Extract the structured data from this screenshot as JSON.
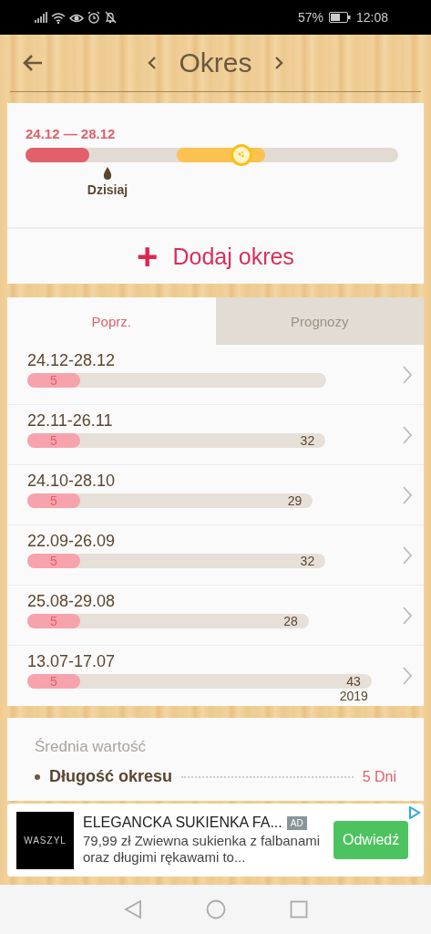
{
  "status_bar": {
    "battery": "57%",
    "time": "12:08"
  },
  "header": {
    "title": "Okres"
  },
  "current": {
    "range": "24.12 — 28.12",
    "period_bar": {
      "level": 0.17
    },
    "today_marker": {
      "level": 0.22,
      "label": "Dzisiaj"
    },
    "add_button": {
      "icon": "+",
      "label": "Dodaj okres"
    }
  },
  "tabs": [
    {
      "label": "Poprz.",
      "selected": true
    },
    {
      "label": "Prognozy",
      "selected": false
    }
  ],
  "periods": [
    {
      "dates": "24.12-28.12",
      "period_days": "5",
      "period_bar": {
        "level": 0.145
      }
    },
    {
      "dates": "22.11-26.11",
      "period_days": "5",
      "cycle_days": "32",
      "period_bar": {
        "level": 0.145
      }
    },
    {
      "dates": "24.10-28.10",
      "period_days": "5",
      "cycle_days": "29",
      "period_bar": {
        "level": 0.145
      }
    },
    {
      "dates": "22.09-26.09",
      "period_days": "5",
      "cycle_days": "32",
      "period_bar": {
        "level": 0.145
      }
    },
    {
      "dates": "25.08-29.08",
      "period_days": "5",
      "cycle_days": "28",
      "period_bar": {
        "level": 0.145
      }
    },
    {
      "dates": "13.07-17.07",
      "period_days": "5",
      "cycle_days": "43",
      "year": "2019",
      "period_bar": {
        "level": 0.145
      }
    }
  ],
  "average": {
    "title": "Średnia wartość",
    "rows": [
      {
        "label": "Długość okresu",
        "value": "5 Dni"
      }
    ]
  },
  "ad": {
    "logo": "WASZYL",
    "title": "ELEGANCKA SUKIENKA FA...",
    "badge": "AD",
    "text": "79,99 zł Zwiewna sukienka z falbanami oraz długimi rękawami to...",
    "button": "Odwiedź"
  }
}
